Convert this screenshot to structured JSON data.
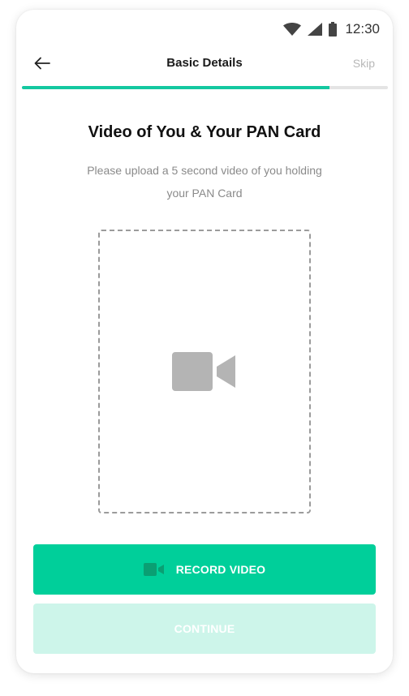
{
  "status_bar": {
    "time": "12:30",
    "icons": [
      "wifi-icon",
      "cellular-signal-icon",
      "battery-icon"
    ]
  },
  "header": {
    "title": "Basic Details",
    "skip_label": "Skip",
    "back_icon": "arrow-left-icon"
  },
  "progress": {
    "fraction": 0.84,
    "color": "#14c8a0"
  },
  "main": {
    "heading": "Video of You & Your PAN Card",
    "subtitle_line1": "Please upload a 5 second video of you holding",
    "subtitle_line2": "your PAN Card",
    "placeholder_icon": "video-camera-icon"
  },
  "actions": {
    "record_label": "RECORD VIDEO",
    "record_icon": "video-camera-icon",
    "continue_label": "CONTINUE"
  },
  "colors": {
    "accent": "#00cf9a",
    "accent_disabled": "#cdf5ea",
    "icon_gray": "#b4b4b4"
  }
}
